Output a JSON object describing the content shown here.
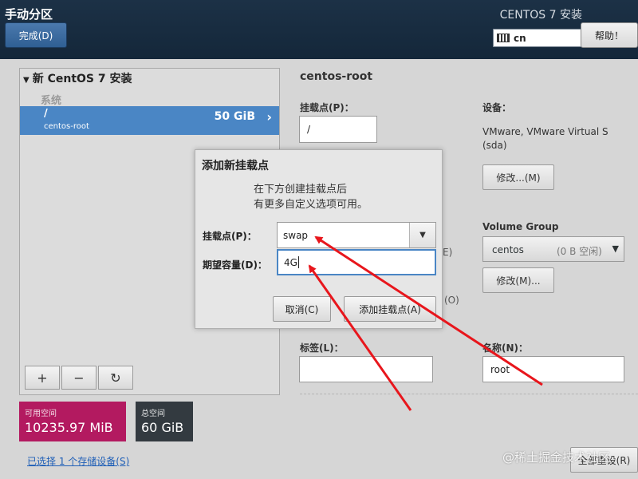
{
  "header": {
    "title": "手动分区",
    "done_button": "完成(D)",
    "product": "CENTOS 7 安装",
    "keyboard_layout": "cn",
    "help_button": "帮助！"
  },
  "left_panel": {
    "install_title": "新 CentOS 7 安装",
    "system_label": "系统",
    "mount": {
      "path": "/",
      "name": "centos-root",
      "size": "50 GiB"
    },
    "controls": {
      "add": "+",
      "remove": "−",
      "refresh": "↻"
    }
  },
  "space": {
    "available_label": "可用空间",
    "available_value": "10235.97 MiB",
    "total_label": "总空间",
    "total_value": "60 GiB",
    "storage_link": "已选择 1 个存储设备(S)"
  },
  "details": {
    "name": "centos-root",
    "mount_point_label": "挂载点(P)：",
    "mount_point_value": "/",
    "device_label": "设备：",
    "device_text": "VMware, VMware Virtual S (sda)",
    "modify_device_button": "修改...(M)",
    "volume_group_label": "Volume Group",
    "volume_group_name": "centos",
    "volume_group_free": "(0 B 空闲)",
    "modify_vg_button": "修改(M)...",
    "tag_label": "标签(L)：",
    "tag_value": "",
    "name_label": "名称(N)：",
    "name_value": "root",
    "peek_e": "E)",
    "peek_o": "(O)",
    "bottom_button": "全部重设(R)"
  },
  "dialog": {
    "title": "添加新挂载点",
    "description_line1": "在下方创建挂载点后",
    "description_line2": "有更多自定义选项可用。",
    "mount_point_label": "挂载点(P)：",
    "mount_point_value": "swap",
    "capacity_label": "期望容量(D)：",
    "capacity_value": "4G",
    "cancel_button": "取消(C)",
    "add_button": "添加挂载点(A)"
  },
  "watermark": "@稀土掘金技术社区",
  "colors": {
    "header_bg": "#1c3146",
    "selection": "#4a86c5",
    "available_space": "#b31a60",
    "total_space": "#333a40",
    "annotation_arrow": "#e8161c"
  }
}
